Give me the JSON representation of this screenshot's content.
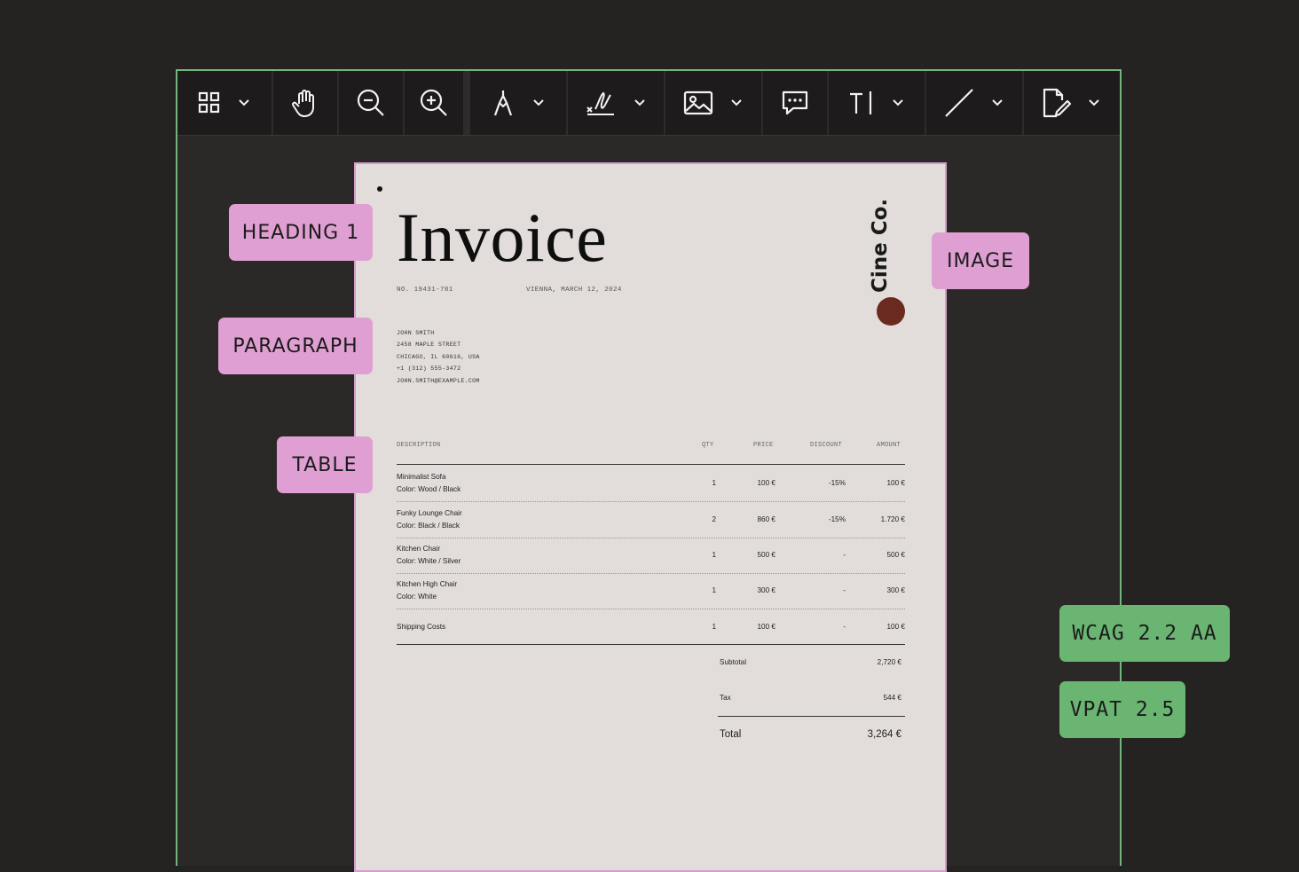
{
  "toolbar": {
    "icons": [
      "grid-icon",
      "hand-icon",
      "zoom-out-icon",
      "zoom-in-icon",
      "pen-icon",
      "signature-icon",
      "image-icon",
      "comment-icon",
      "text-cursor-icon",
      "line-icon",
      "edit-document-icon"
    ]
  },
  "invoice": {
    "title": "Invoice",
    "number": "NO. 19431-781",
    "place_date": "VIENNA, MARCH 12, 2024",
    "brand": "Cine Co.",
    "brand_color": "#6a2a1f",
    "address": [
      "JOHN SMITH",
      "2458 MAPLE STREET",
      "CHICAGO, IL 60616, USA",
      "+1 (312) 555-3472",
      "JOHN.SMITH@EXAMPLE.COM"
    ],
    "columns": {
      "description": "DESCRIPTION",
      "qty": "QTY",
      "price": "PRICE",
      "discount": "DISCOUNT",
      "amount": "AMOUNT"
    },
    "rows": [
      {
        "name": "Minimalist Sofa",
        "detail": "Color: Wood / Black",
        "qty": "1",
        "price": "100 €",
        "discount": "-15%",
        "amount": "100 €"
      },
      {
        "name": "Funky Lounge Chair",
        "detail": "Color: Black / Black",
        "qty": "2",
        "price": "860 €",
        "discount": "-15%",
        "amount": "1.720 €"
      },
      {
        "name": "Kitchen Chair",
        "detail": "Color: White / Silver",
        "qty": "1",
        "price": "500 €",
        "discount": "-",
        "amount": "500 €"
      },
      {
        "name": "Kitchen High Chair",
        "detail": "Color: White",
        "qty": "1",
        "price": "300 €",
        "discount": "-",
        "amount": "300 €"
      },
      {
        "name": "Shipping Costs",
        "detail": "",
        "qty": "1",
        "price": "100 €",
        "discount": "-",
        "amount": "100 €"
      }
    ],
    "subtotal_label": "Subtotal",
    "subtotal": "2,720 €",
    "tax_label": "Tax",
    "tax": "544 €",
    "total_label": "Total",
    "total": "3,264 €"
  },
  "tags": {
    "heading": "HEADING 1",
    "paragraph": "PARAGRAPH",
    "table": "TABLE",
    "image": "IMAGE",
    "wcag": "WCAG 2.2 AA",
    "vpat": "VPAT 2.5"
  },
  "colors": {
    "tag_pink": "#e09fd2",
    "tag_green": "#6ab571",
    "frame_green": "#72b57e",
    "page_border": "#d79bcc"
  }
}
